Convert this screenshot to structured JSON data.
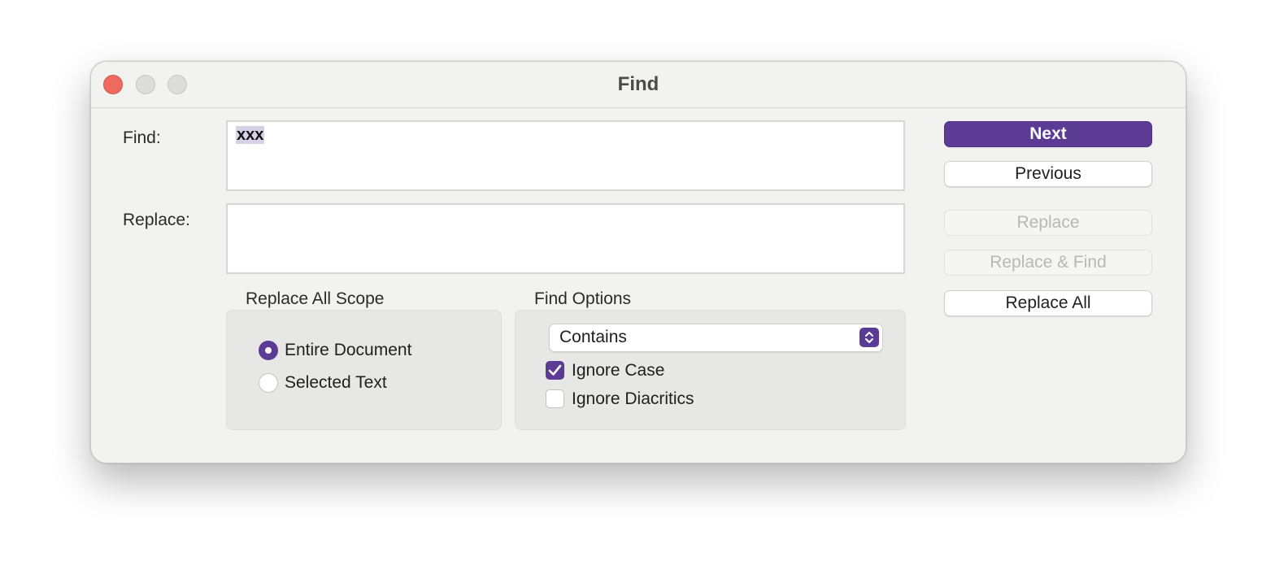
{
  "window": {
    "title": "Find"
  },
  "find": {
    "label": "Find:",
    "value": "xxx"
  },
  "replace": {
    "label": "Replace:",
    "value": ""
  },
  "scope": {
    "title": "Replace All Scope",
    "options": [
      {
        "label": "Entire Document",
        "selected": true
      },
      {
        "label": "Selected Text",
        "selected": false
      }
    ]
  },
  "find_options": {
    "title": "Find Options",
    "match_mode": "Contains",
    "ignore_case": {
      "label": "Ignore Case",
      "checked": true
    },
    "ignore_diacritics": {
      "label": "Ignore Diacritics",
      "checked": false
    }
  },
  "buttons": {
    "next": {
      "label": "Next",
      "enabled": true
    },
    "previous": {
      "label": "Previous",
      "enabled": true
    },
    "replace": {
      "label": "Replace",
      "enabled": false
    },
    "replace_find": {
      "label": "Replace & Find",
      "enabled": false
    },
    "replace_all": {
      "label": "Replace All",
      "enabled": true
    }
  },
  "colors": {
    "accent": "#5b3b93",
    "selection": "#d7d1e6",
    "close": "#ee6a5f"
  }
}
